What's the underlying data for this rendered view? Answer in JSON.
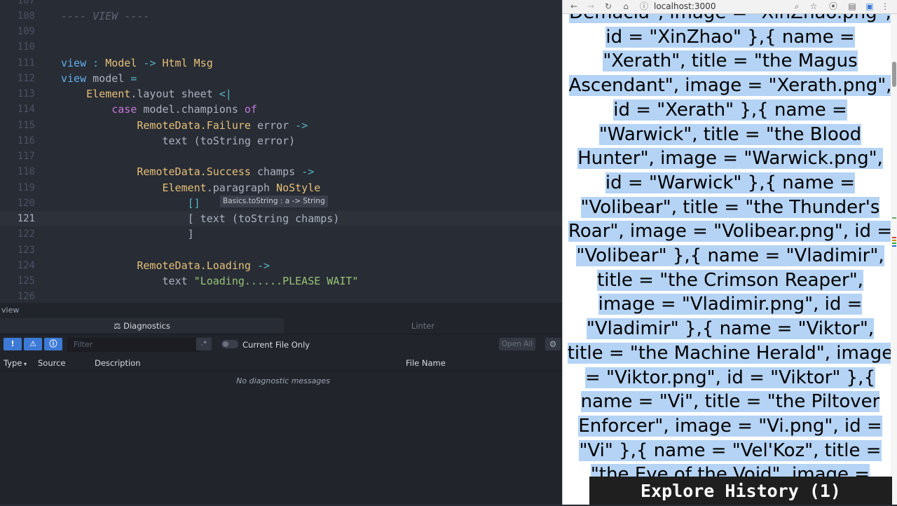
{
  "editor": {
    "lines": [
      {
        "num": "107",
        "html": ""
      },
      {
        "num": "108",
        "tokens": [
          {
            "c": "cm",
            "t": "---- VIEW ----"
          }
        ]
      },
      {
        "num": "109",
        "tokens": []
      },
      {
        "num": "110",
        "tokens": []
      },
      {
        "num": "111",
        "tokens": [
          {
            "c": "fn",
            "t": "view"
          },
          {
            "c": "op",
            "t": " : "
          },
          {
            "c": "ty",
            "t": "Model"
          },
          {
            "c": "op",
            "t": " -> "
          },
          {
            "c": "ty",
            "t": "Html"
          },
          {
            "c": "plain",
            "t": " "
          },
          {
            "c": "ty",
            "t": "Msg"
          }
        ]
      },
      {
        "num": "112",
        "tokens": [
          {
            "c": "fn",
            "t": "view"
          },
          {
            "c": "plain",
            "t": " model "
          },
          {
            "c": "op",
            "t": "="
          }
        ]
      },
      {
        "num": "113",
        "tokens": [
          {
            "c": "plain",
            "t": "    "
          },
          {
            "c": "ty",
            "t": "Element"
          },
          {
            "c": "plain",
            "t": ".layout sheet "
          },
          {
            "c": "op",
            "t": "<|"
          }
        ]
      },
      {
        "num": "114",
        "tokens": [
          {
            "c": "plain",
            "t": "        "
          },
          {
            "c": "kw",
            "t": "case"
          },
          {
            "c": "plain",
            "t": " model.champions "
          },
          {
            "c": "kw",
            "t": "of"
          }
        ]
      },
      {
        "num": "115",
        "tokens": [
          {
            "c": "plain",
            "t": "            "
          },
          {
            "c": "ty",
            "t": "RemoteData.Failure"
          },
          {
            "c": "plain",
            "t": " error "
          },
          {
            "c": "op",
            "t": "->"
          }
        ]
      },
      {
        "num": "116",
        "tokens": [
          {
            "c": "plain",
            "t": "                text (toString error)"
          }
        ]
      },
      {
        "num": "117",
        "tokens": []
      },
      {
        "num": "118",
        "tokens": [
          {
            "c": "plain",
            "t": "            "
          },
          {
            "c": "ty",
            "t": "RemoteData.Success"
          },
          {
            "c": "plain",
            "t": " champs "
          },
          {
            "c": "op",
            "t": "->"
          }
        ]
      },
      {
        "num": "119",
        "tokens": [
          {
            "c": "plain",
            "t": "                "
          },
          {
            "c": "ty",
            "t": "Element"
          },
          {
            "c": "plain",
            "t": ".paragraph "
          },
          {
            "c": "ty",
            "t": "NoStyle"
          }
        ]
      },
      {
        "num": "120",
        "tokens": [
          {
            "c": "plain",
            "t": "                    "
          },
          {
            "c": "op",
            "t": "[]"
          }
        ]
      },
      {
        "num": "121",
        "active": true,
        "tokens": [
          {
            "c": "plain",
            "t": "                    [ text (toString champs)"
          }
        ]
      },
      {
        "num": "122",
        "tokens": [
          {
            "c": "plain",
            "t": "                    ]"
          }
        ]
      },
      {
        "num": "123",
        "tokens": []
      },
      {
        "num": "124",
        "tokens": [
          {
            "c": "plain",
            "t": "            "
          },
          {
            "c": "ty",
            "t": "RemoteData.Loading"
          },
          {
            "c": "plain",
            "t": " "
          },
          {
            "c": "op",
            "t": "->"
          }
        ]
      },
      {
        "num": "125",
        "tokens": [
          {
            "c": "plain",
            "t": "                text "
          },
          {
            "c": "str",
            "t": "\"Loading......PLEASE WAIT\""
          }
        ]
      },
      {
        "num": "126",
        "tokens": []
      }
    ],
    "tooltip": "Basics.toString : a -> String"
  },
  "statusline": "view",
  "diagnostics": {
    "tab_diagnostics": "Diagnostics",
    "tab_linter": "Linter",
    "filter_placeholder": "Filter",
    "regex_label": ".*",
    "current_file_only": "Current File Only",
    "open_all": "Open All",
    "columns": [
      "Type",
      "Source",
      "Description",
      "File Name"
    ],
    "empty": "No diagnostic messages",
    "severity": [
      "!",
      "⚠",
      "ⓘ"
    ]
  },
  "browser": {
    "url": "localhost:3000",
    "content": "Demacia\", image = \"XinZhao.png\", id = \"XinZhao\" },{ name = \"Xerath\", title = \"the Magus Ascendant\", image = \"Xerath.png\", id = \"Xerath\" },{ name = \"Warwick\", title = \"the Blood Hunter\", image = \"Warwick.png\", id = \"Warwick\" },{ name = \"Volibear\", title = \"the Thunder's Roar\", image = \"Volibear.png\", id = \"Volibear\" },{ name = \"Vladimir\", title = \"the Crimson Reaper\", image = \"Vladimir.png\", id = \"Vladimir\" },{ name = \"Viktor\", title = \"the Machine Herald\", image = \"Viktor.png\", id = \"Viktor\" },{ name = \"Vi\", title = \"the Piltover Enforcer\", image = \"Vi.png\", id = \"Vi\" },{ name = \"Vel'Koz\", title = \"the Eye of the Void\", image = \"Velkoz.png\", id = \"Velkoz\" }"
  },
  "overlay": "Explore History (1)"
}
